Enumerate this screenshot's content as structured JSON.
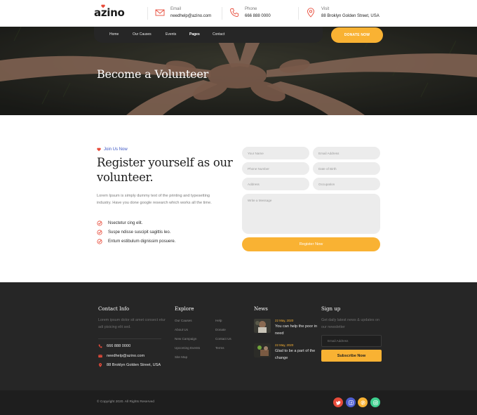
{
  "header": {
    "logo_text": "azino",
    "contacts": [
      {
        "label": "Email",
        "value": "needhelp@azino.com",
        "icon": "mail-icon"
      },
      {
        "label": "Phone",
        "value": "666 888 0000",
        "icon": "phone-icon"
      },
      {
        "label": "Visit",
        "value": "88 Broklyn Golden Street, USA",
        "icon": "location-pin-icon"
      }
    ]
  },
  "nav": {
    "items": [
      "Home",
      "Our Causes",
      "Events",
      "Pages",
      "Contact"
    ],
    "active": "Pages",
    "donate_label": "DONATE NOW"
  },
  "hero": {
    "title": "Become a Volunteer"
  },
  "register": {
    "tagline": "Join Us Now",
    "title": "Register yourself as our volunteer.",
    "description": "Lorem Ipsum is simply dummy text of the printing and typesetting industry. Have you done google research which works all the time.",
    "checks": [
      "Nsectetur cing elit.",
      "Suspe ndisse suscipit sagittis leo.",
      "Entum estibulum dignissim posuere."
    ],
    "form": {
      "name_placeholder": "Your Name",
      "email_placeholder": "Email Address",
      "phone_placeholder": "Phone Number",
      "dob_placeholder": "Date of Birth",
      "address_placeholder": "Address",
      "occupation_placeholder": "Occupation",
      "message_placeholder": "Write a Message",
      "submit_label": "Register Now"
    }
  },
  "footer": {
    "contact_info": {
      "heading": "Contact Info",
      "text": "Lorem ipsum dolor sit amet consect etur adi pisicing elit sed.",
      "phone": "666 888 0000",
      "email": "needhelp@azino.com",
      "address": "88 Broklyn Golden Street, USA"
    },
    "explore": {
      "heading": "Explore",
      "col1": [
        "Our Causes",
        "About Us",
        "New Campaign",
        "Upcoming Events",
        "Site Map"
      ],
      "col2": [
        "Help",
        "Donate",
        "Contact Us",
        "Terms"
      ]
    },
    "news": {
      "heading": "News",
      "items": [
        {
          "date": "22 May, 2020",
          "title": "You can help the poor in need"
        },
        {
          "date": "22 May, 2020",
          "title": "Glad to be a part of the change"
        }
      ]
    },
    "signup": {
      "heading": "Sign up",
      "text": "Get daily latest news & updates on our newsletter",
      "email_placeholder": "Email Address",
      "button_label": "Subscribe Now"
    },
    "copyright": "© Copyright 2020. All Rights Reserved",
    "social": [
      {
        "icon": "twitter-icon",
        "color": "#e84b3a"
      },
      {
        "icon": "facebook-icon",
        "color": "#4f5fd1"
      },
      {
        "icon": "pinterest-icon",
        "color": "#f9b233"
      },
      {
        "icon": "instagram-icon",
        "color": "#3ecf8e"
      }
    ]
  },
  "colors": {
    "accent": "#f9b233",
    "dark": "#262626",
    "link_blue": "#3a55c4",
    "heart_red": "#e84b3a"
  }
}
